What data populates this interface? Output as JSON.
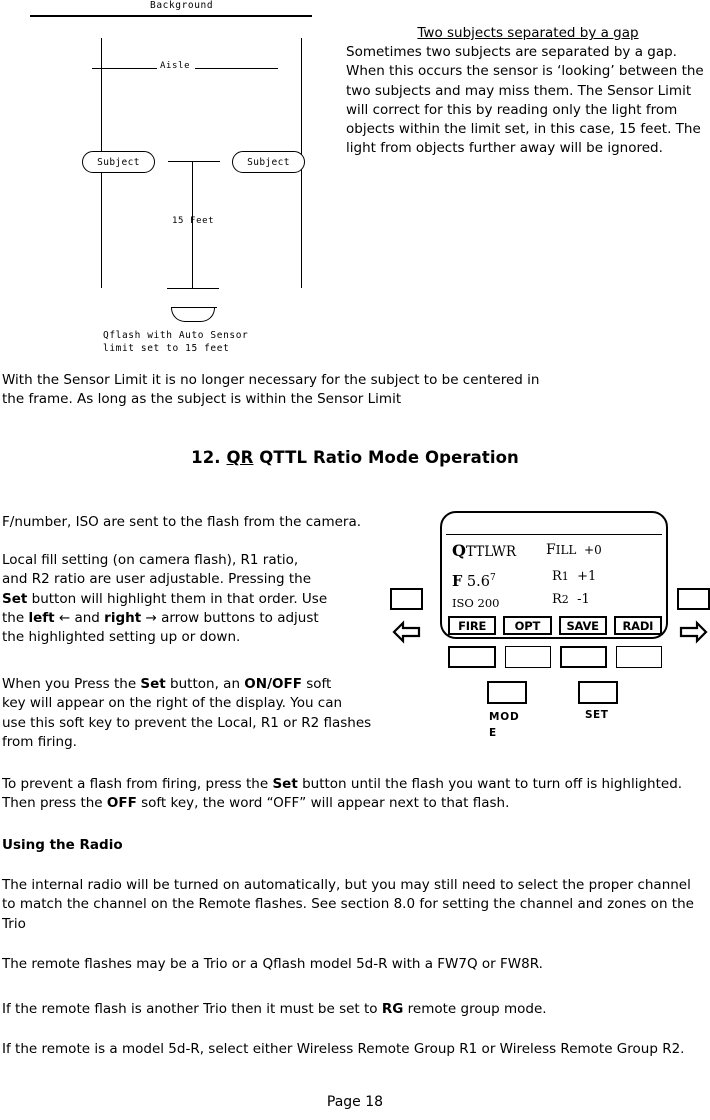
{
  "diagram": {
    "background_label": "Background",
    "aisle_label": "Aisle",
    "subject_left": "Subject",
    "subject_right": "Subject",
    "distance_label": "15 Feet",
    "caption_line1": "Qflash with Auto Sensor",
    "caption_line2": "limit set to 15 feet"
  },
  "gap_section": {
    "title": "Two subjects separated by a gap",
    "body": "Sometimes two subjects are separated by a gap.  When this occurs the sensor is ‘looking’ between the two subjects and may miss them.  The Sensor Limit will correct for this by reading only the light from objects within the limit set, in this case, 15 feet.  The light from objects further away will be ignored."
  },
  "mid_paragraph": "With the Sensor Limit it is no longer necessary for the subject to be centered in the frame.  As long as the subject is within the Sensor Limit",
  "section_heading": {
    "number": "12.",
    "underlined": "QR",
    "rest": "QTTL Ratio Mode Operation"
  },
  "body": {
    "para_1": "F/number, ISO are sent to the flash from the camera.",
    "para_2_pre": "Local fill setting (on camera flash), R1 ratio,\nand R2 ratio are user adjustable.  Pressing the\n",
    "para_2_set": "Set",
    "para_2_mid": " button will highlight them in that order. Use\n the ",
    "para_2_left": "left",
    "para_2_leftarrow": "←",
    "para_2_and": " and ",
    "para_2_right": "right",
    "para_2_rightarrow": "→",
    "para_2_end": " arrow buttons to adjust\nthe  highlighted setting up or down.",
    "para_3_pre": "When you Press the ",
    "para_3_set": "Set",
    "para_3_mid": " button, an ",
    "para_3_onoff": "ON/OFF",
    "para_3_end": " soft\n key will appear on the right of the display.  You can\nuse this soft key to prevent the Local, R1 or R2 flashes\n from firing.",
    "para_4_pre": "To prevent a flash from firing, press the ",
    "para_4_set": "Set",
    "para_4_mid": " button until the flash you want to turn off is highlighted. Then press the ",
    "para_4_off": "OFF",
    "para_4_end": " soft key, the word “OFF” will appear next to that flash.",
    "radio_heading": "Using the Radio",
    "para_5": "The internal radio will be turned on automatically, but you may still need to select the proper channel to match the channel on the Remote flashes. See section 8.0 for setting the channel and zones on the Trio",
    "para_6": "The remote flashes may be a Trio or a Qflash model 5d-R with a FW7Q or FW8R.",
    "para_7_pre": "If the remote flash is another Trio then it must be set to ",
    "para_7_rg": "RG",
    "para_7_end": " remote group mode.",
    "para_8": "If the remote is a model 5d-R,  select either Wireless Remote Group R1 or Wireless Remote Group R2."
  },
  "footer": "Page 18",
  "device": {
    "mode_q": "Q",
    "mode_rest": "TTLWR",
    "f_label": "F",
    "f_value": "5.6",
    "f_superscript": "7",
    "iso": "ISO 200",
    "fill_label": "F",
    "fill_label_rest": "ILL",
    "fill_value": "+0",
    "r1_label": "R",
    "r1_sub": "1",
    "r1_value": "+1",
    "r2_label": "R",
    "r2_sub": "2",
    "r2_value": "-1",
    "softkeys": [
      {
        "label": "FIRE"
      },
      {
        "label": "OPT"
      },
      {
        "label": "SAVE"
      },
      {
        "label": "RADI"
      }
    ],
    "mode_button_label": "MODE",
    "set_button_label": "SET"
  },
  "colors": {
    "ink": "#000000",
    "paper": "#ffffff"
  }
}
